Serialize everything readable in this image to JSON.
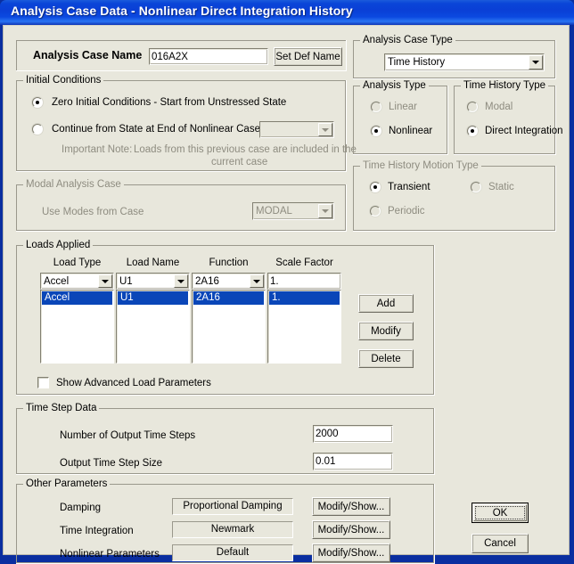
{
  "window": {
    "title": "Analysis Case Data - Nonlinear Direct Integration History"
  },
  "case_name": {
    "label": "Analysis Case Name",
    "value": "016A2X",
    "set_def_name_button": "Set Def Name"
  },
  "initial_conditions": {
    "title": "Initial Conditions",
    "option_zero": "Zero Initial Conditions - Start from Unstressed State",
    "option_continue": "Continue from State at End of Nonlinear Case",
    "continue_case_value": "",
    "note_label": "Important Note:",
    "note_line1": "Loads from this previous case are included in the",
    "note_line2": "current case"
  },
  "modal_analysis_case": {
    "title": "Modal Analysis Case",
    "use_modes_label": "Use Modes from Case",
    "value": "MODAL"
  },
  "analysis_case_type": {
    "title": "Analysis Case Type",
    "value": "Time History"
  },
  "analysis_type": {
    "title": "Analysis Type",
    "option_linear": "Linear",
    "option_nonlinear": "Nonlinear"
  },
  "time_history_type": {
    "title": "Time History Type",
    "option_modal": "Modal",
    "option_direct": "Direct Integration"
  },
  "time_history_motion_type": {
    "title": "Time History Motion Type",
    "option_transient": "Transient",
    "option_static": "Static",
    "option_periodic": "Periodic"
  },
  "loads_applied": {
    "title": "Loads Applied",
    "headers": [
      "Load Type",
      "Load Name",
      "Function",
      "Scale Factor"
    ],
    "editors": {
      "load_type": "Accel",
      "load_name": "U1",
      "function": "2A16",
      "scale_factor": "1."
    },
    "rows": [
      {
        "load_type": "Accel",
        "load_name": "U1",
        "function": "2A16",
        "scale_factor": "1."
      }
    ],
    "buttons": {
      "add": "Add",
      "modify": "Modify",
      "delete": "Delete"
    },
    "show_advanced_label": "Show Advanced Load Parameters",
    "show_advanced_checked": false
  },
  "time_step_data": {
    "title": "Time Step Data",
    "number_of_output_time_steps_label": "Number of Output Time Steps",
    "number_of_output_time_steps_value": "2000",
    "output_time_step_size_label": "Output Time Step Size",
    "output_time_step_size_value": "0.01"
  },
  "other_parameters": {
    "title": "Other Parameters",
    "rows": [
      {
        "label": "Damping",
        "value": "Proportional Damping",
        "button": "Modify/Show..."
      },
      {
        "label": "Time Integration",
        "value": "Newmark",
        "button": "Modify/Show..."
      },
      {
        "label": "Nonlinear Parameters",
        "value": "Default",
        "button": "Modify/Show..."
      }
    ]
  },
  "dialog_buttons": {
    "ok": "OK",
    "cancel": "Cancel"
  },
  "colors": {
    "title_bar_blue": "#0a3fd6",
    "dialog_face": "#e8e7dc",
    "selection_blue": "#0a46b8",
    "disabled_text": "#8e8c80"
  }
}
